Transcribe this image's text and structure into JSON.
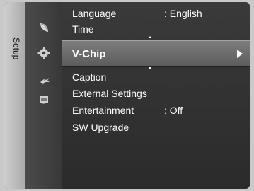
{
  "sidebar": {
    "tab_label": "Setup"
  },
  "menu": {
    "items": [
      {
        "label": "Language",
        "value": ": English"
      },
      {
        "label": "Time",
        "value": ""
      },
      {
        "label": "V-Chip",
        "value": ""
      },
      {
        "label": "Caption",
        "value": ""
      },
      {
        "label": "External Settings",
        "value": ""
      },
      {
        "label": "Entertainment",
        "value": ": Off"
      },
      {
        "label": "SW Upgrade",
        "value": ""
      }
    ],
    "selected_index": 2
  },
  "icons": [
    "satellite-dish-icon",
    "gear-icon",
    "bird-icon",
    "monitor-icon"
  ]
}
